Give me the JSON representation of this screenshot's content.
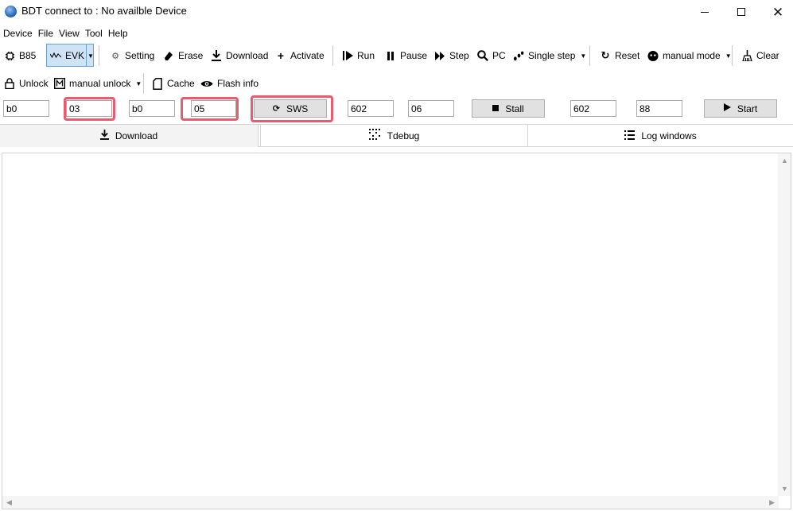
{
  "window": {
    "title": "BDT connect to : No availble Device"
  },
  "menu": [
    "Device",
    "File",
    "View",
    "Tool",
    "Help"
  ],
  "toolbar1": {
    "chip": "B85",
    "board": "EVK",
    "setting": "Setting",
    "erase": "Erase",
    "download": "Download",
    "activate": "Activate",
    "run": "Run",
    "pause": "Pause",
    "step": "Step",
    "pc": "PC",
    "single_step": "Single step",
    "reset": "Reset",
    "manual_mode": "manual mode",
    "clear": "Clear"
  },
  "toolbar2": {
    "unlock": "Unlock",
    "manual_unlock": "manual unlock",
    "cache": "Cache",
    "flash_info": "Flash info"
  },
  "sws_row": {
    "addr1": "b0",
    "val1": "03",
    "addr2": "b0",
    "val2": "05",
    "sws_label": "SWS",
    "stall_addr": "602",
    "stall_val": "06",
    "stall_label": "Stall",
    "start_addr": "602",
    "start_val": "88",
    "start_label": "Start"
  },
  "tabs": {
    "download": "Download",
    "tdebug": "Tdebug",
    "log": "Log windows"
  },
  "colors": {
    "highlight": "#ea5b6f",
    "selected_bg": "#cfe3f7"
  }
}
